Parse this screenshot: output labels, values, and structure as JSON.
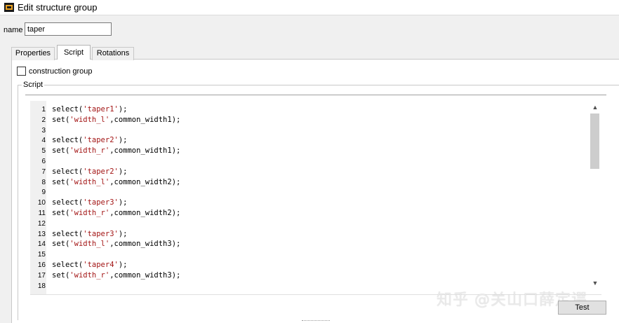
{
  "window": {
    "title": "Edit structure group",
    "icon": "structure-group-app-icon"
  },
  "name_field": {
    "label": "name",
    "value": "taper"
  },
  "tabs": [
    {
      "label": "Properties",
      "active": false
    },
    {
      "label": "Script",
      "active": true
    },
    {
      "label": "Rotations",
      "active": false
    }
  ],
  "construction_group": {
    "label": "construction group",
    "checked": false
  },
  "script_group": {
    "title": "Script"
  },
  "editor": {
    "lines": [
      {
        "n": "1",
        "pre": "select(",
        "str": "'taper1'",
        "post": ");"
      },
      {
        "n": "2",
        "pre": "set(",
        "str": "'width_l'",
        "post": ",common_width1);"
      },
      {
        "n": "3",
        "pre": "",
        "str": "",
        "post": ""
      },
      {
        "n": "4",
        "pre": "select(",
        "str": "'taper2'",
        "post": ");"
      },
      {
        "n": "5",
        "pre": "set(",
        "str": "'width_r'",
        "post": ",common_width1);"
      },
      {
        "n": "6",
        "pre": "",
        "str": "",
        "post": ""
      },
      {
        "n": "7",
        "pre": "select(",
        "str": "'taper2'",
        "post": ");"
      },
      {
        "n": "8",
        "pre": "set(",
        "str": "'width_l'",
        "post": ",common_width2);"
      },
      {
        "n": "9",
        "pre": "",
        "str": "",
        "post": ""
      },
      {
        "n": "10",
        "pre": "select(",
        "str": "'taper3'",
        "post": ");"
      },
      {
        "n": "11",
        "pre": "set(",
        "str": "'width_r'",
        "post": ",common_width2);"
      },
      {
        "n": "12",
        "pre": "",
        "str": "",
        "post": ""
      },
      {
        "n": "13",
        "pre": "select(",
        "str": "'taper3'",
        "post": ");"
      },
      {
        "n": "14",
        "pre": "set(",
        "str": "'width_l'",
        "post": ",common_width3);"
      },
      {
        "n": "15",
        "pre": "",
        "str": "",
        "post": ""
      },
      {
        "n": "16",
        "pre": "select(",
        "str": "'taper4'",
        "post": ");"
      },
      {
        "n": "17",
        "pre": "set(",
        "str": "'width_r'",
        "post": ",common_width3);"
      },
      {
        "n": "18",
        "pre": "",
        "str": "",
        "post": ""
      }
    ],
    "string_color": "#a31515"
  },
  "test_button": {
    "label": "Test"
  },
  "watermark": "知乎 @关山口薛定谔",
  "colors": {
    "window_bg": "#f0f0f0",
    "panel_bg": "#ffffff",
    "scroll_thumb": "#cdcdcd"
  }
}
